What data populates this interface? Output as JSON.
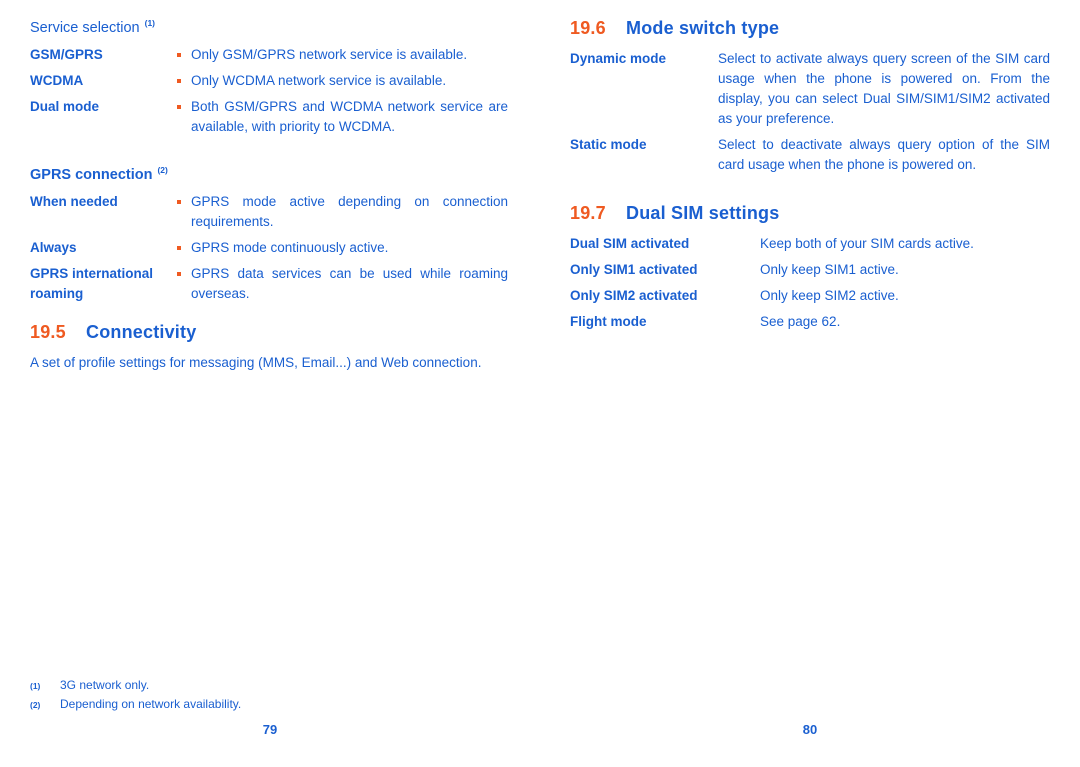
{
  "document": {
    "color_text": "#1a5fd0",
    "color_accent": "#ef5a21"
  },
  "left_page": {
    "page_number": "79",
    "service_selection": {
      "heading": "Service selection",
      "footnote_marker": "(1)",
      "rows": [
        {
          "term": "GSM/GPRS",
          "desc": "Only GSM/GPRS network service is available."
        },
        {
          "term": "WCDMA",
          "desc": "Only WCDMA network service is available."
        },
        {
          "term": "Dual mode",
          "desc": "Both GSM/GPRS and WCDMA network service are available, with priority to WCDMA."
        }
      ]
    },
    "gprs_connection": {
      "heading": "GPRS connection",
      "footnote_marker": "(2)",
      "rows": [
        {
          "term": "When needed",
          "desc": "GPRS mode active depending on connection requirements."
        },
        {
          "term": "Always",
          "desc": "GPRS mode continuously active."
        },
        {
          "term": "GPRS international roaming",
          "desc": "GPRS data services can be used while roaming overseas."
        }
      ]
    },
    "connectivity": {
      "number": "19.5",
      "title": "Connectivity",
      "body": "A set of profile settings for messaging (MMS, Email...) and Web connection."
    },
    "footnotes": [
      {
        "marker": "(1)",
        "text": "3G network only."
      },
      {
        "marker": "(2)",
        "text": "Depending on network availability."
      }
    ]
  },
  "right_page": {
    "page_number": "80",
    "mode_switch_type": {
      "number": "19.6",
      "title": "Mode switch type",
      "rows": [
        {
          "term": "Dynamic mode",
          "desc": "Select to activate always query screen of the SIM card usage when the phone is powered on. From the display, you can select Dual SIM/SIM1/SIM2 activated as your preference."
        },
        {
          "term": "Static mode",
          "desc": "Select to deactivate always query option of the SIM card usage when the phone is powered on."
        }
      ]
    },
    "dual_sim_settings": {
      "number": "19.7",
      "title": "Dual SIM settings",
      "rows": [
        {
          "term": "Dual SIM activated",
          "desc": "Keep both of your SIM cards active."
        },
        {
          "term": "Only SIM1 activated",
          "desc": "Only keep SIM1 active."
        },
        {
          "term": "Only SIM2 activated",
          "desc": "Only keep SIM2 active."
        },
        {
          "term": "Flight mode",
          "desc": "See page 62."
        }
      ]
    }
  }
}
